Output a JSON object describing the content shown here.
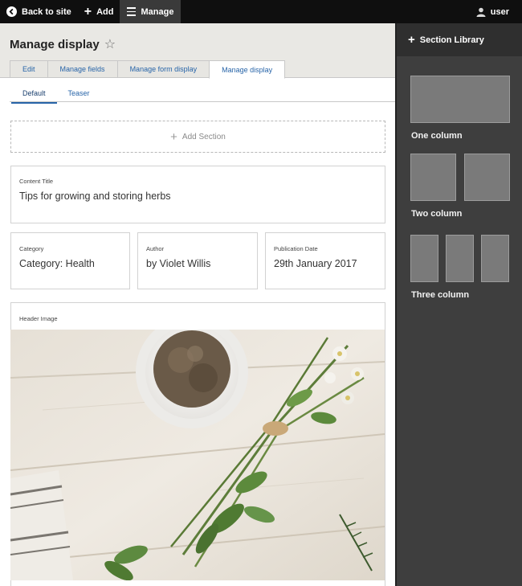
{
  "toolbar": {
    "back_label": "Back to site",
    "add_label": "Add",
    "manage_label": "Manage",
    "user_label": "user"
  },
  "page": {
    "title": "Manage display",
    "tabs": [
      {
        "label": "Edit"
      },
      {
        "label": "Manage fields"
      },
      {
        "label": "Manage form display"
      },
      {
        "label": "Manage display",
        "active": true
      }
    ],
    "subtabs": [
      {
        "label": "Default",
        "active": true
      },
      {
        "label": "Teaser"
      }
    ],
    "add_section_label": "Add Section"
  },
  "fields": {
    "content_title": {
      "label": "Content Title",
      "value": "Tips for growing and storing herbs"
    },
    "category": {
      "label": "Category",
      "value": "Category: Health"
    },
    "author": {
      "label": "Author",
      "value": "by Violet Willis"
    },
    "publication_date": {
      "label": "Publication Date",
      "value": "29th January 2017"
    },
    "header_image": {
      "label": "Header Image"
    }
  },
  "sidebar": {
    "title": "Section Library",
    "layouts": [
      {
        "label": "One column",
        "columns": 1
      },
      {
        "label": "Two column",
        "columns": 2
      },
      {
        "label": "Three column",
        "columns": 3
      }
    ]
  },
  "colors": {
    "toolbar_bg": "#0f0f0f",
    "sidebar_bg": "#3e3e3e",
    "link_blue": "#2764a8",
    "page_head_bg": "#e9e8e4"
  }
}
